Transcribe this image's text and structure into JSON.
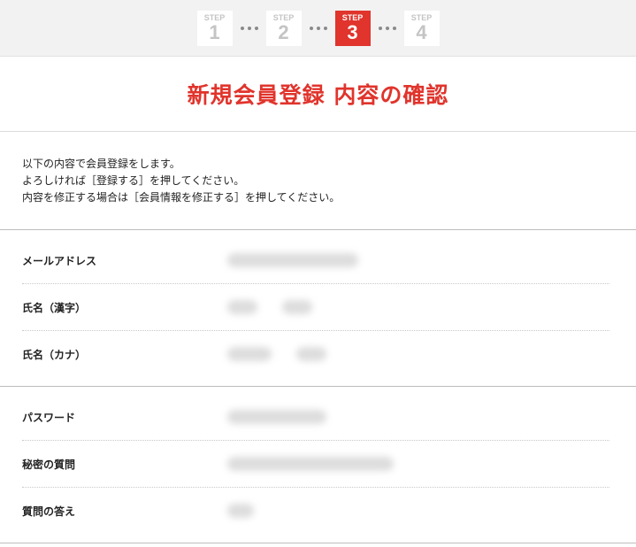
{
  "steps": [
    {
      "label": "STEP",
      "num": "1",
      "active": false
    },
    {
      "label": "STEP",
      "num": "2",
      "active": false
    },
    {
      "label": "STEP",
      "num": "3",
      "active": true
    },
    {
      "label": "STEP",
      "num": "4",
      "active": false
    }
  ],
  "colors": {
    "accent": "#e0342c",
    "step_inactive": "#c4c4c4",
    "stepbar_bg": "#f2f2f2"
  },
  "header": {
    "title": "新規会員登録 内容の確認"
  },
  "intro": {
    "line1": "以下の内容で会員登録をします。",
    "line2": "よろしければ［登録する］を押してください。",
    "line3": "内容を修正する場合は［会員情報を修正する］を押してください。"
  },
  "section_account": {
    "email_label": "メールアドレス",
    "name_kanji_label": "氏名（漢字）",
    "name_kana_label": "氏名（カナ）"
  },
  "section_security": {
    "password_label": "パスワード",
    "question_label": "秘密の質問",
    "answer_label": "質問の答え"
  }
}
